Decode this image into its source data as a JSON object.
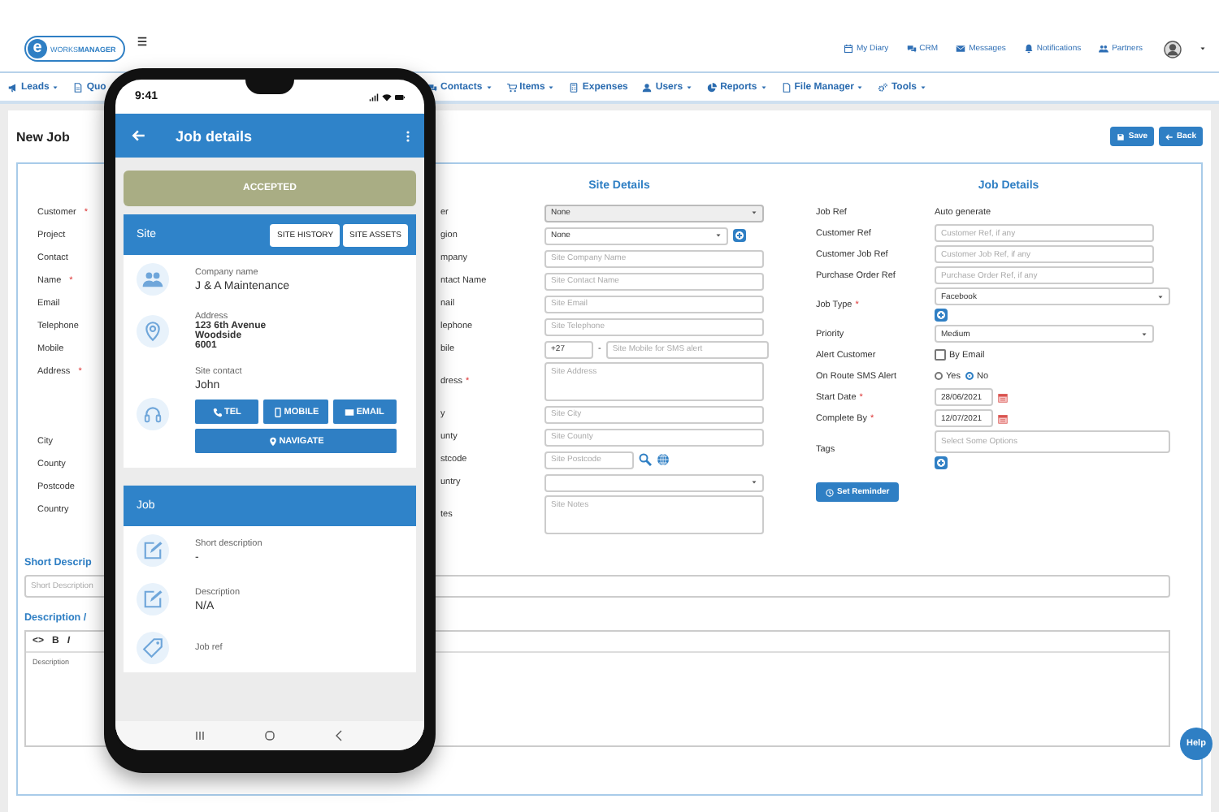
{
  "header": {
    "logo": {
      "mark": "e",
      "text": "WORKS**MANAGER**"
    },
    "links": [
      {
        "label": "My Diary"
      },
      {
        "label": "CRM"
      },
      {
        "label": "Messages"
      },
      {
        "label": "Notifications"
      },
      {
        "label": "Partners"
      }
    ]
  },
  "nav": {
    "left": [
      {
        "label": "Leads",
        "dropdown": true
      },
      {
        "label": "Quo",
        "dropdown": false
      }
    ],
    "right": [
      {
        "label": "Contacts",
        "dropdown": true
      },
      {
        "label": "Items",
        "dropdown": true
      },
      {
        "label": "Expenses",
        "dropdown": false
      },
      {
        "label": "Users",
        "dropdown": true
      },
      {
        "label": "Reports",
        "dropdown": true
      },
      {
        "label": "File Manager",
        "dropdown": true
      },
      {
        "label": "Tools",
        "dropdown": true
      }
    ]
  },
  "page": {
    "title": "New Job",
    "buttons": [
      {
        "label": "Save"
      },
      {
        "label": "Back"
      }
    ]
  },
  "customer_labels": [
    {
      "label": "Customer",
      "required_mark": "*",
      "kind": "line"
    },
    {
      "label": "Project",
      "kind": "line"
    },
    {
      "label": "Contact",
      "kind": "line"
    },
    {
      "label": "Name",
      "required_mark": "*",
      "kind": "line"
    },
    {
      "label": "Email",
      "kind": "line"
    },
    {
      "label": "Telephone",
      "kind": "line"
    },
    {
      "label": "Mobile",
      "kind": "line"
    },
    {
      "label": "Address",
      "required_mark": "*",
      "kind": "tall"
    },
    {
      "label": "City",
      "kind": "line"
    },
    {
      "label": "County",
      "kind": "line"
    },
    {
      "label": "Postcode",
      "kind": "line"
    },
    {
      "label": "Country",
      "kind": "line"
    }
  ],
  "site_details": {
    "title": "Site Details",
    "rows": [
      {
        "label": "er",
        "kind": "select",
        "value": "None",
        "disabled": true,
        "add": false
      },
      {
        "label": "gion",
        "kind": "select",
        "value": "None",
        "disabled": false,
        "add": true
      },
      {
        "label": "mpany",
        "kind": "text",
        "placeholder": "Site Company Name"
      },
      {
        "label": "ntact Name",
        "kind": "text",
        "placeholder": "Site Contact Name"
      },
      {
        "label": "nail",
        "kind": "text",
        "placeholder": "Site Email"
      },
      {
        "label": "lephone",
        "kind": "text",
        "placeholder": "Site Telephone"
      },
      {
        "label": "bile",
        "kind": "phone",
        "code": "+27",
        "separator": "-",
        "placeholder": "Site Mobile for SMS alert"
      },
      {
        "label": "dress",
        "required_mark": "*",
        "kind": "textarea",
        "placeholder": "Site Address"
      },
      {
        "label": "y",
        "kind": "text",
        "placeholder": "Site City"
      },
      {
        "label": "unty",
        "kind": "text",
        "placeholder": "Site County"
      },
      {
        "label": "stcode",
        "kind": "postcode",
        "placeholder": "Site Postcode"
      },
      {
        "label": "untry",
        "kind": "select",
        "disabled": false,
        "add": false
      },
      {
        "label": "tes",
        "kind": "textarea",
        "placeholder": "Site Notes"
      }
    ]
  },
  "job_details": {
    "title": "Job Details",
    "rows": [
      {
        "label": "Job Ref",
        "kind": "static",
        "value": "Auto generate"
      },
      {
        "label": "Customer Ref",
        "kind": "text",
        "placeholder": "Customer Ref, if any"
      },
      {
        "label": "Customer Job Ref",
        "kind": "text",
        "placeholder": "Customer Job Ref, if any"
      },
      {
        "label": "Purchase Order Ref",
        "kind": "text",
        "placeholder": "Purchase Order Ref, if any"
      },
      {
        "label": "Job Type",
        "required_mark": "*",
        "kind": "select",
        "value": "Facebook",
        "add": true
      },
      {
        "label": "Priority",
        "kind": "select",
        "value": "Medium",
        "add": false
      },
      {
        "label": "Alert Customer",
        "kind": "checkbox",
        "text": "By Email",
        "checked": false
      },
      {
        "label": "On Route SMS Alert",
        "kind": "radios",
        "options": [
          {
            "label": "Yes",
            "selected": false
          },
          {
            "label": "No",
            "selected": true
          }
        ]
      },
      {
        "label": "Start Date",
        "required_mark": "*",
        "kind": "date",
        "value": "28/06/2021"
      },
      {
        "label": "Complete By",
        "required_mark": "*",
        "kind": "date",
        "value": "12/07/2021"
      },
      {
        "label": "Tags",
        "kind": "tags",
        "placeholder": "Select Some Options",
        "add": true
      }
    ],
    "reminder": {
      "label": "Set Reminder"
    }
  },
  "short_description": {
    "title": "Short Descrip",
    "placeholder": "Short Description"
  },
  "description": {
    "title": "Description /",
    "toolbar": [
      "<>",
      "B",
      "I"
    ],
    "placeholder": "Description"
  },
  "help": {
    "label": "Help"
  },
  "phone": {
    "time": "9:41",
    "title": "Job details",
    "status": "ACCEPTED",
    "site": {
      "title": "Site",
      "buttons": [
        "SITE HISTORY",
        "SITE ASSETS"
      ],
      "items": [
        {
          "label": "Company name",
          "value": "J & A Maintenance"
        },
        {
          "label": "Address",
          "lines": [
            "123 6th Avenue",
            "Woodside",
            "6001"
          ]
        },
        {
          "label": "Site contact",
          "value": "John",
          "actions": [
            "TEL",
            "MOBILE",
            "EMAIL"
          ],
          "navigate": "NAVIGATE"
        }
      ]
    },
    "job": {
      "title": "Job",
      "items": [
        {
          "label": "Short description",
          "value": "-"
        },
        {
          "label": "Description",
          "value": "N/A"
        },
        {
          "label": "Job ref"
        }
      ]
    }
  }
}
